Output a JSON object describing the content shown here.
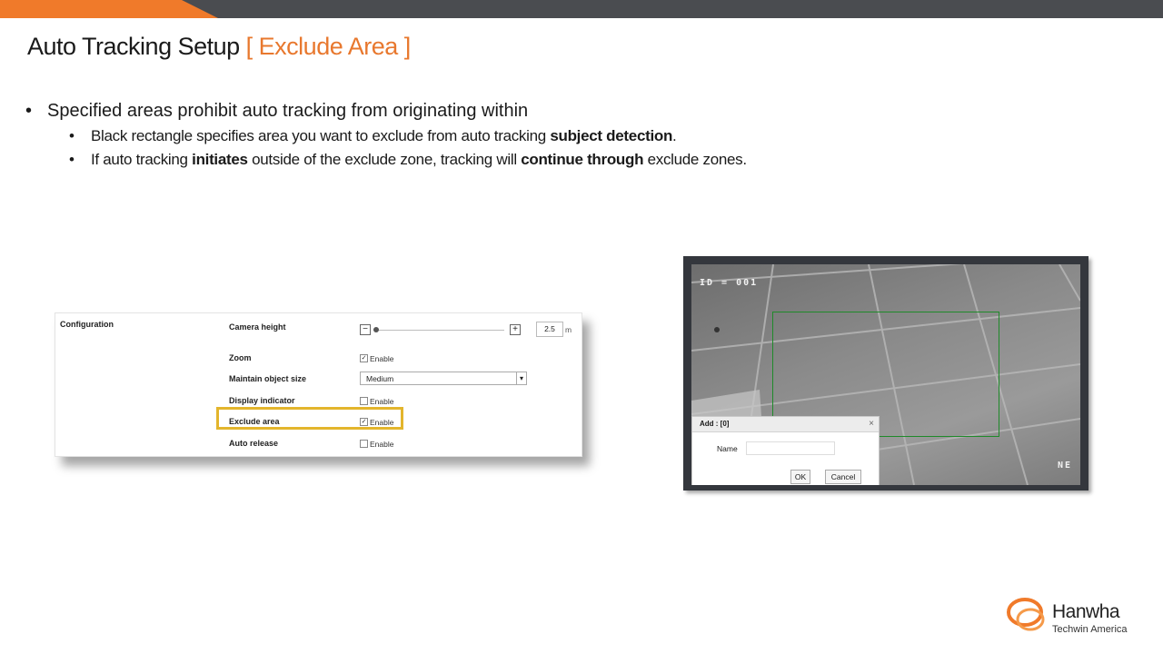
{
  "slide": {
    "title_main": "Auto Tracking Setup",
    "title_accent": "[ Exclude Area ]"
  },
  "bullets": {
    "level1": "Specified areas prohibit auto tracking from originating within",
    "sub1": {
      "pre": "Black rectangle specifies area you want to exclude from auto tracking ",
      "bold": "subject detection",
      "post": "."
    },
    "sub2": {
      "pre": "If auto tracking ",
      "bold1": "initiates",
      "mid": " outside of the exclude zone, tracking will ",
      "bold2": "continue through",
      "post": " exclude zones."
    },
    "bullet_char": "•"
  },
  "config": {
    "section_title": "Configuration",
    "camera_height_label": "Camera height",
    "camera_height_value": "2.5",
    "camera_height_unit": "m",
    "slider_minus": "−",
    "slider_plus": "+",
    "slider_fraction": 0.0,
    "zoom_label": "Zoom",
    "zoom_enable": "Enable",
    "zoom_checked": true,
    "maintain_label": "Maintain object size",
    "maintain_value": "Medium",
    "display_label": "Display indicator",
    "display_enable": "Enable",
    "display_checked": false,
    "exclude_label": "Exclude area",
    "exclude_enable": "Enable",
    "exclude_checked": true,
    "autorelease_label": "Auto release",
    "autorelease_enable": "Enable",
    "autorelease_checked": false,
    "check_mark": "✓",
    "highlight_color": "#e3b52c"
  },
  "camera": {
    "id_text": "ID = 001",
    "direction": "NE",
    "zone_color": "#1f8a2a",
    "dialog": {
      "title": "Add : [0]",
      "close": "×",
      "name_label": "Name",
      "name_value": "",
      "ok": "OK",
      "cancel": "Cancel"
    }
  },
  "logo": {
    "brand": "Hanwha",
    "sub": "Techwin America",
    "accent": "#f07a2a"
  }
}
